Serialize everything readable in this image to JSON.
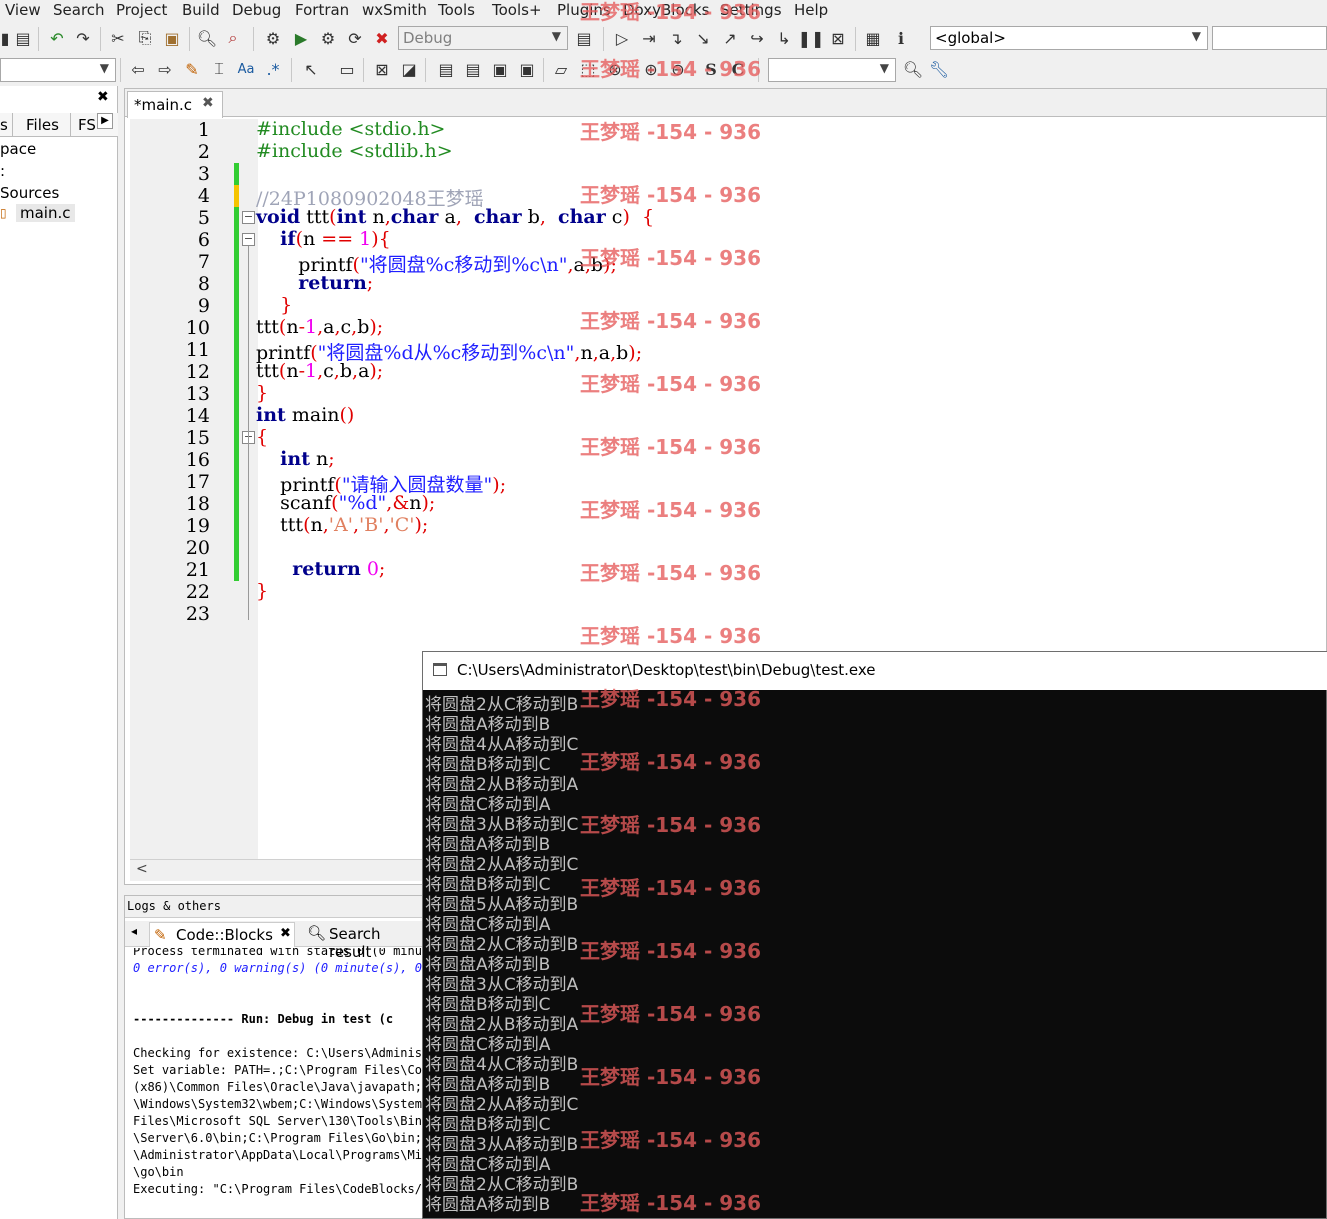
{
  "menu": [
    "View",
    "Search",
    "Project",
    "Build",
    "Debug",
    "Fortran",
    "wxSmith",
    "Tools",
    "Tools+",
    "Plugins",
    "DoxyBlocks",
    "Settings",
    "Help"
  ],
  "toolbar": {
    "build_target": "Debug",
    "scope": "<global>",
    "search_value": ""
  },
  "left_panel": {
    "tabs": [
      "s",
      "Files",
      "FS"
    ],
    "tree": [
      "pace",
      ":",
      "Sources",
      "main.c"
    ]
  },
  "editor": {
    "tab_label": "*main.c",
    "line_numbers": [
      "1",
      "2",
      "3",
      "4",
      "5",
      "6",
      "7",
      "8",
      "9",
      "10",
      "11",
      "12",
      "13",
      "14",
      "15",
      "16",
      "17",
      "18",
      "19",
      "20",
      "21",
      "22",
      "23"
    ]
  },
  "logs": {
    "panel_title": "Logs & others",
    "tabs": [
      "Code::Blocks",
      "Search result"
    ],
    "lines": [
      "Process terminated with status 0 (0 minute",
      "0 error(s), 0 warning(s) (0 minute(s), 0",
      "",
      "",
      "-------------- Run: Debug in test (c",
      "",
      "Checking for existence: C:\\Users\\Administ",
      "Set variable: PATH=.;C:\\Program Files\\Code",
      "(x86)\\Common Files\\Oracle\\Java\\javapath;C",
      "\\Windows\\System32\\wbem;C:\\Windows\\System3",
      "Files\\Microsoft SQL Server\\130\\Tools\\Binn",
      "\\Server\\6.0\\bin;C:\\Program Files\\Go\\bin;C",
      "\\Administrator\\AppData\\Local\\Programs\\Mic",
      "\\go\\bin",
      "Executing: \"C:\\Program Files\\CodeBlocks/c"
    ]
  },
  "console": {
    "title": "C:\\Users\\Administrator\\Desktop\\test\\bin\\Debug\\test.exe",
    "lines": [
      "将圆盘2从C移动到B",
      "将圆盘A移动到B",
      "将圆盘4从A移动到C",
      "将圆盘B移动到C",
      "将圆盘2从B移动到A",
      "将圆盘C移动到A",
      "将圆盘3从B移动到C",
      "将圆盘A移动到B",
      "将圆盘2从A移动到C",
      "将圆盘B移动到C",
      "将圆盘5从A移动到B",
      "将圆盘C移动到A",
      "将圆盘2从C移动到B",
      "将圆盘A移动到B",
      "将圆盘3从C移动到A",
      "将圆盘B移动到C",
      "将圆盘2从B移动到A",
      "将圆盘C移动到A",
      "将圆盘4从C移动到B",
      "将圆盘A移动到B",
      "将圆盘2从A移动到C",
      "将圆盘B移动到C",
      "将圆盘3从A移动到B",
      "将圆盘C移动到A",
      "将圆盘2从C移动到B",
      "将圆盘A移动到B"
    ]
  },
  "watermark": "王梦瑶 -154 - 936",
  "colors": {
    "keyword": "#00008b",
    "preprocessor": "#228b22",
    "comment": "#9fa4b7",
    "string": "#1f1fff",
    "operator": "#e00000",
    "change_marker": "#32cd32",
    "watermark": "#e65c5c",
    "console_bg": "#0c0c0c"
  }
}
